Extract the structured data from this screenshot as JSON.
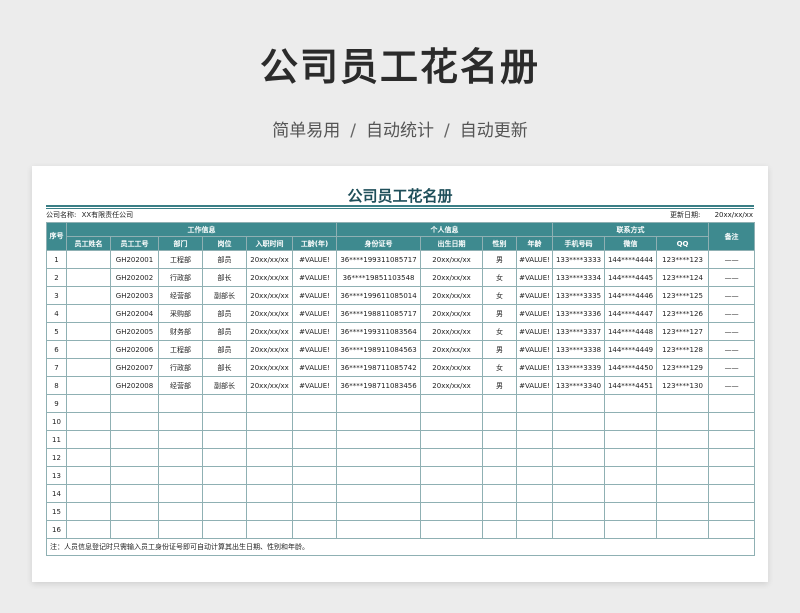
{
  "hero": {
    "title": "公司员工花名册",
    "subtitle": [
      "简单易用",
      "自动统计",
      "自动更新"
    ],
    "separator": "/"
  },
  "sheet": {
    "title": "公司员工花名册",
    "company_label": "公司名称:",
    "company_name": "XX有限责任公司",
    "update_label": "更新日期:",
    "update_value": "20xx/xx/xx",
    "groups": {
      "seq": "序号",
      "work": "工作信息",
      "personal": "个人信息",
      "contact": "联系方式",
      "remark": "备注"
    },
    "columns": [
      "员工姓名",
      "员工工号",
      "部门",
      "岗位",
      "入职时间",
      "工龄(年)",
      "身份证号",
      "出生日期",
      "性别",
      "年龄",
      "手机号码",
      "微信",
      "QQ"
    ],
    "rows": [
      [
        "1",
        "",
        "GH202001",
        "工程部",
        "部员",
        "20xx/xx/xx",
        "#VALUE!",
        "36****199311085717",
        "20xx/xx/xx",
        "男",
        "#VALUE!",
        "133****3333",
        "144****4444",
        "123****123",
        "——"
      ],
      [
        "2",
        "",
        "GH202002",
        "行政部",
        "部长",
        "20xx/xx/xx",
        "#VALUE!",
        "36****19851103548",
        "20xx/xx/xx",
        "女",
        "#VALUE!",
        "133****3334",
        "144****4445",
        "123****124",
        "——"
      ],
      [
        "3",
        "",
        "GH202003",
        "经营部",
        "副部长",
        "20xx/xx/xx",
        "#VALUE!",
        "36****199611085014",
        "20xx/xx/xx",
        "女",
        "#VALUE!",
        "133****3335",
        "144****4446",
        "123****125",
        "——"
      ],
      [
        "4",
        "",
        "GH202004",
        "采购部",
        "部员",
        "20xx/xx/xx",
        "#VALUE!",
        "36****198811085717",
        "20xx/xx/xx",
        "男",
        "#VALUE!",
        "133****3336",
        "144****4447",
        "123****126",
        "——"
      ],
      [
        "5",
        "",
        "GH202005",
        "财务部",
        "部员",
        "20xx/xx/xx",
        "#VALUE!",
        "36****199311083564",
        "20xx/xx/xx",
        "女",
        "#VALUE!",
        "133****3337",
        "144****4448",
        "123****127",
        "——"
      ],
      [
        "6",
        "",
        "GH202006",
        "工程部",
        "部员",
        "20xx/xx/xx",
        "#VALUE!",
        "36****198911084563",
        "20xx/xx/xx",
        "男",
        "#VALUE!",
        "133****3338",
        "144****4449",
        "123****128",
        "——"
      ],
      [
        "7",
        "",
        "GH202007",
        "行政部",
        "部长",
        "20xx/xx/xx",
        "#VALUE!",
        "36****198711085742",
        "20xx/xx/xx",
        "女",
        "#VALUE!",
        "133****3339",
        "144****4450",
        "123****129",
        "——"
      ],
      [
        "8",
        "",
        "GH202008",
        "经营部",
        "副部长",
        "20xx/xx/xx",
        "#VALUE!",
        "36****198711083456",
        "20xx/xx/xx",
        "男",
        "#VALUE!",
        "133****3340",
        "144****4451",
        "123****130",
        "——"
      ],
      [
        "9",
        "",
        "",
        "",
        "",
        "",
        "",
        "",
        "",
        "",
        "",
        "",
        "",
        "",
        ""
      ],
      [
        "10",
        "",
        "",
        "",
        "",
        "",
        "",
        "",
        "",
        "",
        "",
        "",
        "",
        "",
        ""
      ],
      [
        "11",
        "",
        "",
        "",
        "",
        "",
        "",
        "",
        "",
        "",
        "",
        "",
        "",
        "",
        ""
      ],
      [
        "12",
        "",
        "",
        "",
        "",
        "",
        "",
        "",
        "",
        "",
        "",
        "",
        "",
        "",
        ""
      ],
      [
        "13",
        "",
        "",
        "",
        "",
        "",
        "",
        "",
        "",
        "",
        "",
        "",
        "",
        "",
        ""
      ],
      [
        "14",
        "",
        "",
        "",
        "",
        "",
        "",
        "",
        "",
        "",
        "",
        "",
        "",
        "",
        ""
      ],
      [
        "15",
        "",
        "",
        "",
        "",
        "",
        "",
        "",
        "",
        "",
        "",
        "",
        "",
        "",
        ""
      ],
      [
        "16",
        "",
        "",
        "",
        "",
        "",
        "",
        "",
        "",
        "",
        "",
        "",
        "",
        "",
        ""
      ]
    ],
    "note": "注：人员信息登记时只需输入员工身份证号即可自动计算其出生日期、性别和年龄。"
  },
  "colors": {
    "header_bg": "#3e8a8f",
    "title_text": "#1f4f5a",
    "border": "#8fb0b3",
    "page_bg": "#ececec"
  }
}
